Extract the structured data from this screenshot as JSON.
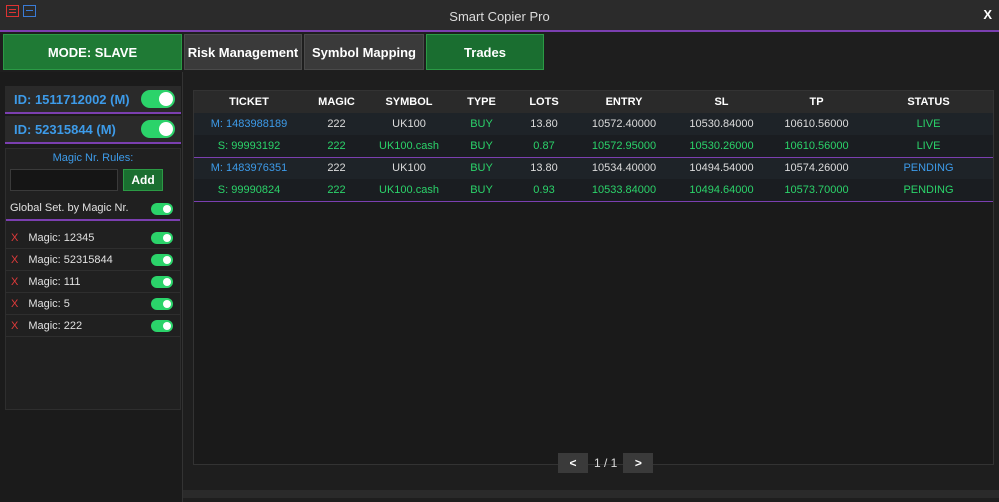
{
  "window": {
    "title": "Smart Copier Pro",
    "close_label": "X"
  },
  "mode_button": "MODE: SLAVE",
  "tabs": [
    {
      "label": "Risk Management",
      "active": false
    },
    {
      "label": "Symbol Mapping",
      "active": false
    },
    {
      "label": "Trades",
      "active": true
    }
  ],
  "accounts": [
    {
      "label": "ID: 1511712002 (M)",
      "enabled": true
    },
    {
      "label": "ID: 52315844 (M)",
      "enabled": true
    }
  ],
  "magic_rules": {
    "title": "Magic Nr. Rules:",
    "input_value": "",
    "add_label": "Add",
    "global_label": "Global Set. by Magic Nr.",
    "remove_label": "X",
    "items": [
      {
        "label": "Magic: 12345",
        "enabled": true
      },
      {
        "label": "Magic: 52315844",
        "enabled": true
      },
      {
        "label": "Magic: 111",
        "enabled": true
      },
      {
        "label": "Magic: 5",
        "enabled": true
      },
      {
        "label": "Magic: 222",
        "enabled": true
      }
    ]
  },
  "trades": {
    "columns": [
      "TICKET",
      "MAGIC",
      "SYMBOL",
      "TYPE",
      "LOTS",
      "ENTRY",
      "SL",
      "TP",
      "STATUS"
    ],
    "rows": [
      {
        "ticket": "M: 1483988189",
        "magic": "222",
        "symbol": "UK100",
        "type": "BUY",
        "lots": "13.80",
        "entry": "10572.40000",
        "sl": "10530.84000",
        "tp": "10610.56000",
        "status": "LIVE",
        "kind": "master"
      },
      {
        "ticket": "S: 99993192",
        "magic": "222",
        "symbol": "UK100.cash",
        "type": "BUY",
        "lots": "0.87",
        "entry": "10572.95000",
        "sl": "10530.26000",
        "tp": "10610.56000",
        "status": "LIVE",
        "kind": "slave"
      },
      {
        "ticket": "M: 1483976351",
        "magic": "222",
        "symbol": "UK100",
        "type": "BUY",
        "lots": "13.80",
        "entry": "10534.40000",
        "sl": "10494.54000",
        "tp": "10574.26000",
        "status": "PENDING",
        "kind": "master"
      },
      {
        "ticket": "S: 99990824",
        "magic": "222",
        "symbol": "UK100.cash",
        "type": "BUY",
        "lots": "0.93",
        "entry": "10533.84000",
        "sl": "10494.64000",
        "tp": "10573.70000",
        "status": "PENDING",
        "kind": "slave"
      }
    ]
  },
  "pager": {
    "prev": "<",
    "text": "1 / 1",
    "next": ">"
  },
  "colors": {
    "accent_purple": "#7b3fb0",
    "green": "#2bd36a",
    "blue": "#3d9be9",
    "remove_red": "#e03a3a"
  }
}
